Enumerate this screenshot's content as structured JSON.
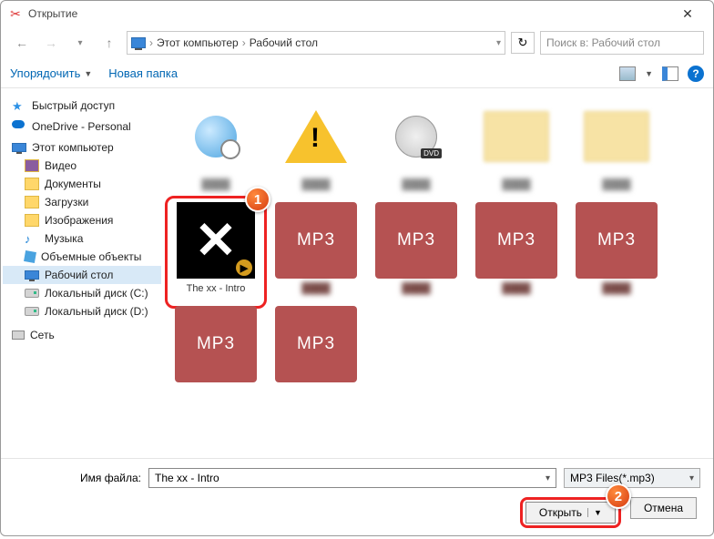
{
  "title": "Открытие",
  "breadcrumb": {
    "root": "Этот компьютер",
    "folder": "Рабочий стол"
  },
  "search_placeholder": "Поиск в: Рабочий стол",
  "toolbar": {
    "organize": "Упорядочить",
    "new_folder": "Новая папка"
  },
  "tree": {
    "quick": "Быстрый доступ",
    "onedrive": "OneDrive - Personal",
    "this_pc": "Этот компьютер",
    "video": "Видео",
    "docs": "Документы",
    "downloads": "Загрузки",
    "images": "Изображения",
    "music": "Музыка",
    "objects3d": "Объемные объекты",
    "desktop": "Рабочий стол",
    "disk_c": "Локальный диск (C:)",
    "disk_d": "Локальный диск (D:)",
    "network": "Сеть"
  },
  "files": {
    "selected": "The xx - Intro",
    "mp3": "MP3"
  },
  "callouts": {
    "one": "1",
    "two": "2"
  },
  "bottom": {
    "label": "Имя файла:",
    "value": "The xx - Intro",
    "filter": "MP3 Files(*.mp3)",
    "open": "Открыть",
    "cancel": "Отмена"
  }
}
